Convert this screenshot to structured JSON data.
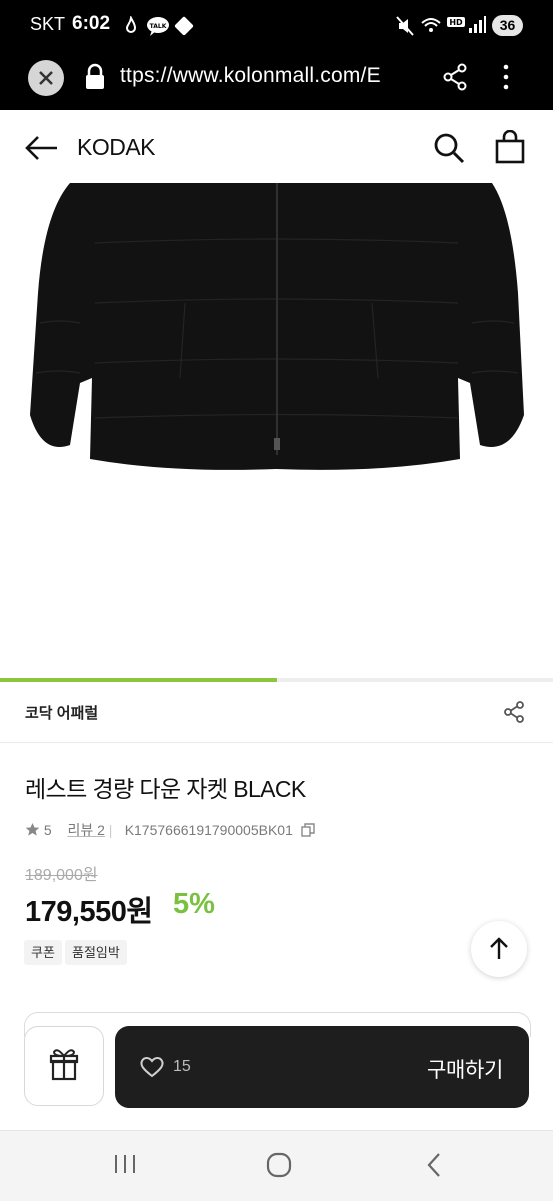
{
  "status_bar": {
    "carrier": "SKT",
    "time": "6:02",
    "battery": "36"
  },
  "browser": {
    "url": "ttps://www.kolonmall.com/E"
  },
  "header": {
    "brand_title": "KODAK"
  },
  "product": {
    "gallery_progress": 0.5,
    "brand_name": "코닥 어패럴",
    "title": "레스트 경량 다운 자켓 BLACK",
    "rating": "5",
    "review_label": "리뷰 2",
    "product_code": "K1757666191790005BK01",
    "original_price": "189,000원",
    "sale_price": "179,550원",
    "discount": "5%",
    "tags": [
      "쿠폰",
      "품절임박"
    ]
  },
  "bottom_bar": {
    "like_count": "15",
    "buy_label": "구매하기"
  },
  "colors": {
    "accent_green": "#7ac142",
    "buy_bar": "#1e1e1e"
  }
}
